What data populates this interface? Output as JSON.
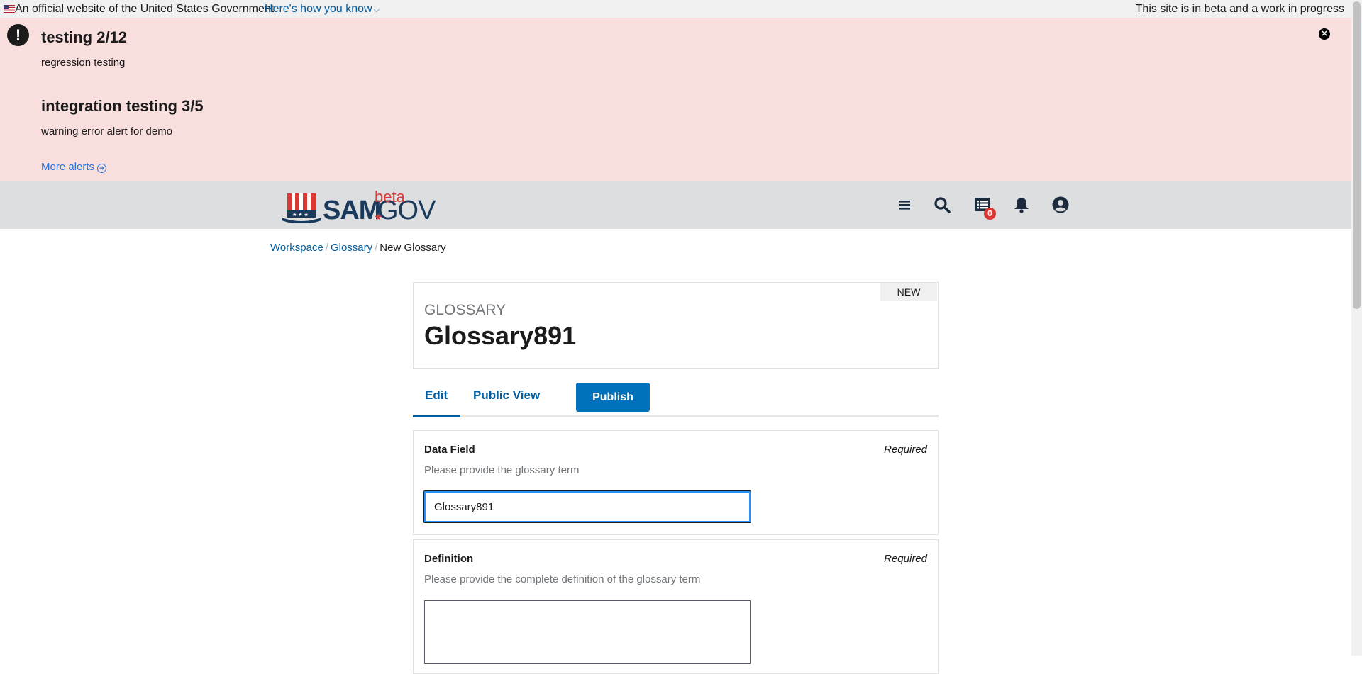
{
  "gov_banner": {
    "official_text": "An official website of the United States Government",
    "how_link": "Here's how you know",
    "beta_text": "This site is in beta and a work in progress"
  },
  "alerts": {
    "items": [
      {
        "title": "testing 2/12",
        "body": "regression testing"
      },
      {
        "title": "integration testing 3/5",
        "body": "warning error alert for demo"
      }
    ],
    "more_link": "More alerts"
  },
  "header": {
    "logo_sam": "SAM",
    "logo_gov": "GOV",
    "logo_beta": "beta",
    "notification_count": "0",
    "icons": [
      "menu-icon",
      "search-icon",
      "messages-icon",
      "bell-icon",
      "user-icon"
    ]
  },
  "breadcrumb": {
    "items": [
      "Workspace",
      "Glossary"
    ],
    "current": "New Glossary"
  },
  "card": {
    "status": "NEW",
    "kicker": "GLOSSARY",
    "title": "Glossary891"
  },
  "tabs": {
    "edit": "Edit",
    "public_view": "Public View",
    "publish": "Publish"
  },
  "fields": {
    "data_field": {
      "label": "Data Field",
      "required": "Required",
      "hint": "Please provide the glossary term",
      "value": "Glossary891"
    },
    "definition": {
      "label": "Definition",
      "required": "Required",
      "hint": "Please provide the complete definition of the glossary term",
      "value": ""
    }
  },
  "colors": {
    "alert_bg": "#f9dede",
    "header_bg": "#dcdee0",
    "link": "#005ea2",
    "primary_button": "#0071bc",
    "badge": "#d83933"
  }
}
